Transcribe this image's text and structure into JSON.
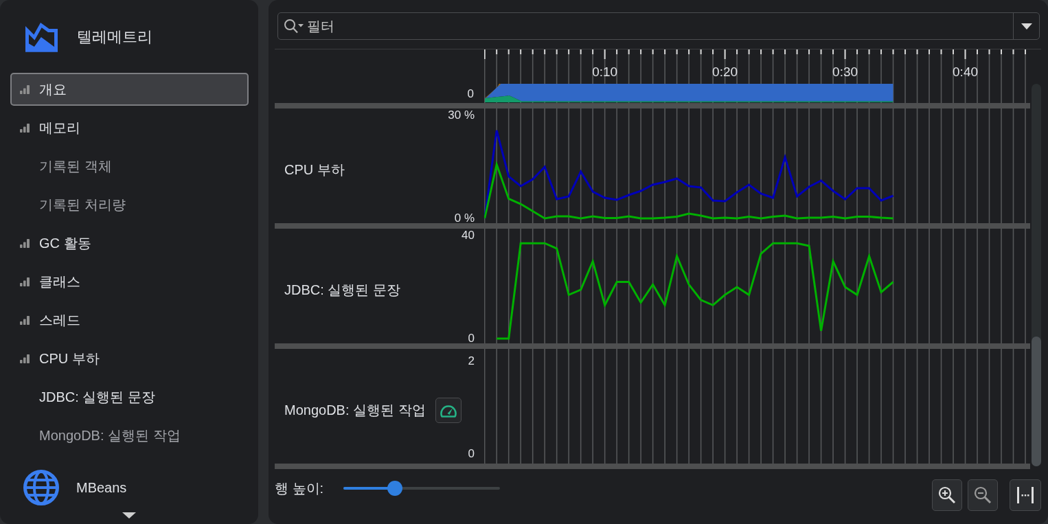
{
  "sidebar": {
    "title": "텔레메트리",
    "items": [
      {
        "label": "개요",
        "kind": "chart",
        "selected": true,
        "disabled": false
      },
      {
        "label": "메모리",
        "kind": "chart",
        "selected": false,
        "disabled": false
      },
      {
        "label": "기록된 객체",
        "kind": "view",
        "selected": false,
        "disabled": true
      },
      {
        "label": "기록된 처리량",
        "kind": "view",
        "selected": false,
        "disabled": true
      },
      {
        "label": "GC 활동",
        "kind": "chart",
        "selected": false,
        "disabled": false
      },
      {
        "label": "클래스",
        "kind": "chart",
        "selected": false,
        "disabled": false
      },
      {
        "label": "스레드",
        "kind": "chart",
        "selected": false,
        "disabled": false
      },
      {
        "label": "CPU 부하",
        "kind": "chart",
        "selected": false,
        "disabled": false
      },
      {
        "label": "JDBC: 실행된 문장",
        "kind": "view",
        "selected": false,
        "disabled": false
      },
      {
        "label": "MongoDB: 실행된 작업",
        "kind": "view",
        "selected": false,
        "disabled": true
      }
    ],
    "footer": {
      "label": "MBeans"
    }
  },
  "filter": {
    "placeholder": "필터"
  },
  "timeline": {
    "ticks": [
      "0:10",
      "0:20",
      "0:30",
      "0:40"
    ]
  },
  "rows": [
    {
      "kind": "overview",
      "axis_label": "0"
    },
    {
      "kind": "chart",
      "title": "CPU 부하",
      "gauge_button": false,
      "chart_data": {
        "type": "line",
        "categories": [
          null,
          null,
          null,
          null,
          null,
          null,
          null,
          null,
          null,
          null,
          null,
          null,
          null,
          null,
          null,
          null,
          null,
          null,
          null,
          null,
          null,
          null,
          null,
          null,
          null,
          null,
          null,
          null,
          null,
          null,
          null,
          null,
          null,
          null,
          null
        ],
        "series": [
          {
            "color": "#0000b8",
            "values": [
              0,
              25.6,
              12.2,
              9.4,
              11.4,
              15,
              5.6,
              6.4,
              13.6,
              7.8,
              6,
              5.4,
              6.8,
              8,
              9.8,
              10.6,
              11.6,
              9.4,
              9,
              5.2,
              5,
              7.6,
              9.8,
              7.2,
              6,
              17.8,
              6.4,
              9.2,
              11,
              8,
              5.6,
              8.8,
              8.8,
              5.2,
              6.6
            ]
          },
          {
            "color": "#00b000",
            "values": [
              0,
              15.7,
              5.7,
              4.2,
              2.1,
              0,
              0.6,
              0.6,
              0,
              0.6,
              0.1,
              0.1,
              0.6,
              0,
              0,
              0.2,
              0.5,
              1.4,
              0.8,
              0,
              0.2,
              0,
              0.5,
              0,
              0.5,
              0.8,
              0,
              0.2,
              0.2,
              0.5,
              0,
              0.5,
              0.5,
              0.2,
              0
            ]
          }
        ],
        "ylim": [
          0,
          30
        ],
        "yticks": [
          {
            "value": 0,
            "label": "0 %"
          },
          {
            "value": 30,
            "label": "30 %"
          }
        ],
        "grid": true
      }
    },
    {
      "kind": "chart",
      "title": "JDBC: 실행된 문장",
      "gauge_button": false,
      "chart_data": {
        "type": "line",
        "categories": [
          null,
          null,
          null,
          null,
          null,
          null,
          null,
          null,
          null,
          null,
          null,
          null,
          null,
          null,
          null,
          null,
          null,
          null,
          null,
          null,
          null,
          null,
          null,
          null,
          null,
          null,
          null,
          null,
          null,
          null,
          null,
          null,
          null,
          null,
          null
        ],
        "series": [
          {
            "color": "#00b000",
            "values": [
              null,
              0,
              0,
              37,
              37,
              37,
              35,
              17,
              19,
              30,
              13,
              22,
              22,
              14,
              21,
              13,
              32,
              21,
              15,
              13,
              17,
              20,
              17,
              33,
              37,
              37,
              37,
              36,
              3,
              30,
              20,
              17,
              32,
              18,
              22
            ]
          }
        ],
        "ylim": [
          0,
          40
        ],
        "yticks": [
          {
            "value": 0,
            "label": "0"
          },
          {
            "value": 40,
            "label": "40"
          }
        ],
        "grid": true
      }
    },
    {
      "kind": "blank",
      "title": "MongoDB: 실행된 작업",
      "gauge_button": true,
      "axis_labels": [
        "2",
        "0"
      ]
    }
  ],
  "row_height": {
    "label": "행 높이:",
    "level": 0.33
  },
  "zoom_buttons": [
    {
      "kind": "zoom_in",
      "disabled": false
    },
    {
      "kind": "zoom_out",
      "disabled": true
    },
    {
      "kind": "fit",
      "disabled": false
    }
  ]
}
